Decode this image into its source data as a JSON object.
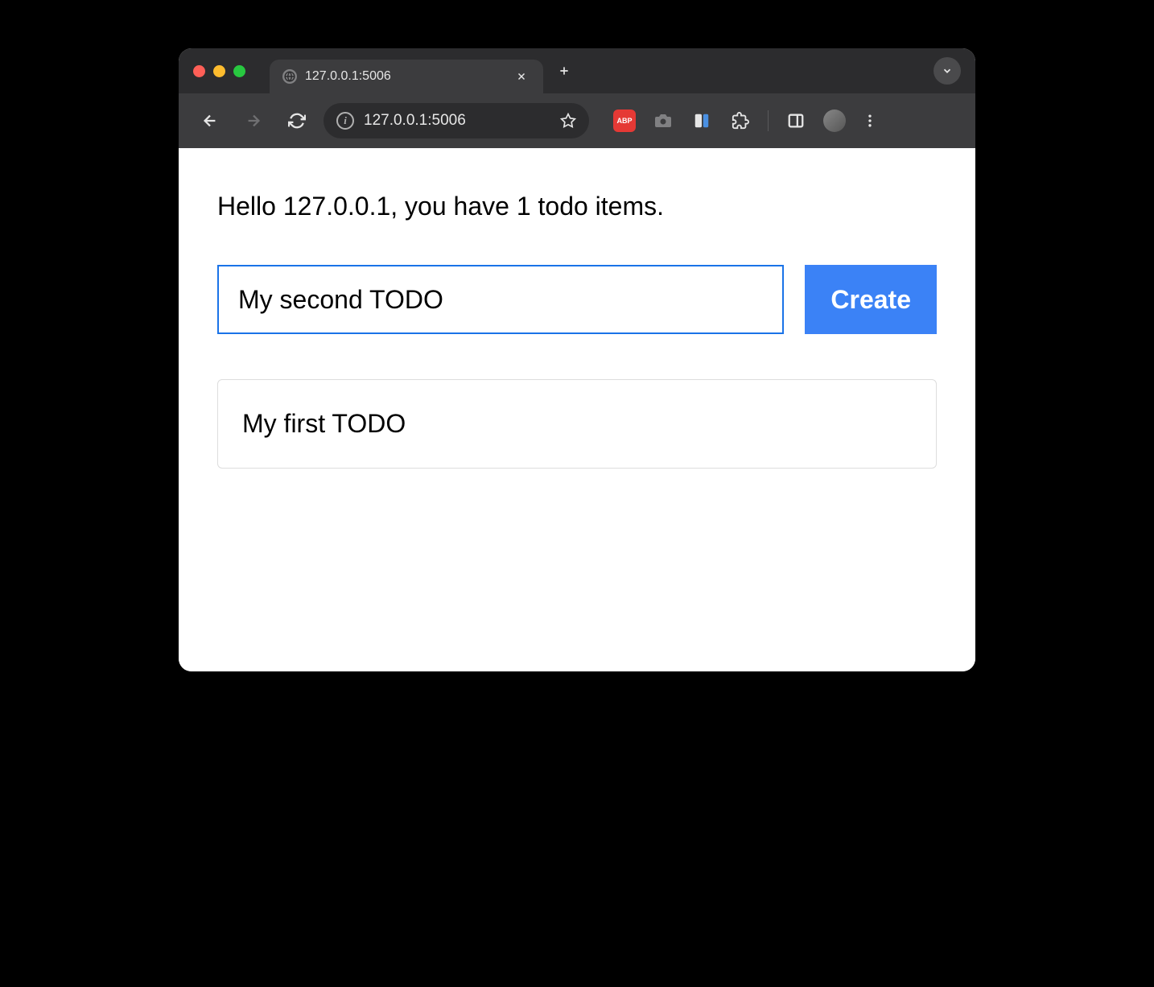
{
  "browser": {
    "tab_title": "127.0.0.1:5006",
    "url": "127.0.0.1:5006",
    "abp_label": "ABP"
  },
  "page": {
    "greeting": "Hello 127.0.0.1, you have 1 todo items.",
    "input_value": "My second TODO",
    "create_label": "Create",
    "todos": [
      {
        "text": "My first TODO"
      }
    ]
  }
}
